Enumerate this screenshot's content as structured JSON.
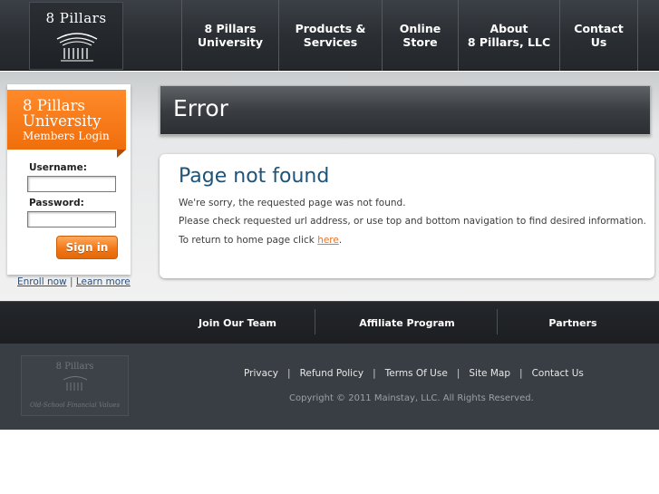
{
  "header": {
    "logo_text": "8 Pillars",
    "nav": [
      {
        "label": "8 Pillars\nUniversity"
      },
      {
        "label": "Products &\nServices"
      },
      {
        "label": "Online\nStore"
      },
      {
        "label": "About\n8 Pillars, LLC"
      },
      {
        "label": "Contact\nUs"
      }
    ]
  },
  "login": {
    "title_line1": "8 Pillars",
    "title_line2": "University",
    "title_line3": "Members Login",
    "username_label": "Username:",
    "password_label": "Password:",
    "username_value": "",
    "password_value": "",
    "signin_label": "Sign in",
    "enroll_label": "Enroll now",
    "separator": "|",
    "learn_label": "Learn more"
  },
  "main": {
    "error_title": "Error",
    "heading": "Page not found",
    "line1": "We're sorry, the requested page was not found.",
    "line2": "Please check requested url address, or use top and bottom navigation to find desired information.",
    "line3_prefix": "To return to home page click ",
    "line3_link": "here",
    "line3_suffix": "."
  },
  "subnav": [
    {
      "label": "Join Our Team"
    },
    {
      "label": "Affiliate Program"
    },
    {
      "label": "Partners"
    }
  ],
  "footer": {
    "logo_text": "8 Pillars",
    "logo_tagline": "Old-School Financial Values",
    "links": [
      "Privacy",
      "Refund Policy",
      "Terms Of Use",
      "Site Map",
      "Contact Us"
    ],
    "separator": "|",
    "copyright": "Copyright © 2011 Mainstay, LLC. All Rights Reserved."
  },
  "colors": {
    "accent_orange": "#f27718",
    "heading_blue": "#1f5378",
    "link_blue": "#2b4f7a",
    "dark_header": "#2a2e33",
    "footer_bg": "#393e44"
  }
}
